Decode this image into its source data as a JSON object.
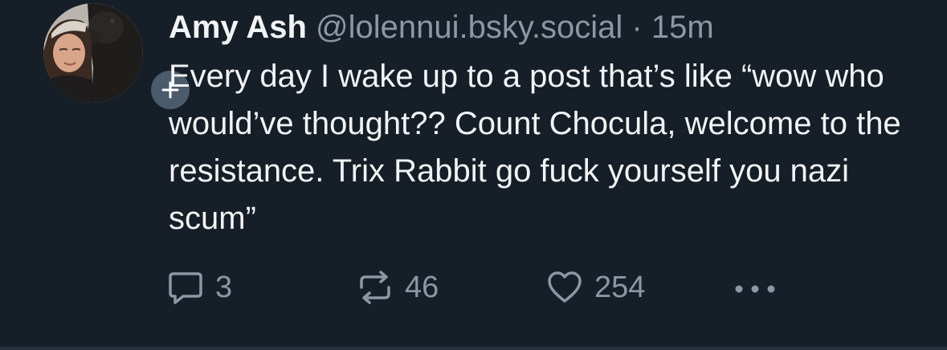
{
  "post": {
    "author_name": "Amy Ash",
    "handle": "@lolennui.bsky.social",
    "separator": "·",
    "time": "15m",
    "text": "Every day I wake up to a post that’s like “wow who would’ve thought?? Count Chocula, welcome to the resistance. Trix Rabbit go fuck yourself you nazi scum”",
    "follow_icon": "plus-icon"
  },
  "actions": {
    "reply": {
      "icon": "reply-bubble-icon",
      "count": "3"
    },
    "repost": {
      "icon": "repost-icon",
      "count": "46"
    },
    "like": {
      "icon": "heart-icon",
      "count": "254"
    },
    "more": {
      "icon": "more-horizontal-icon"
    }
  },
  "colors": {
    "background": "#161e27",
    "text": "#f1f3f5",
    "muted": "#8b97a5",
    "follow_button": "#4a5b6c"
  }
}
